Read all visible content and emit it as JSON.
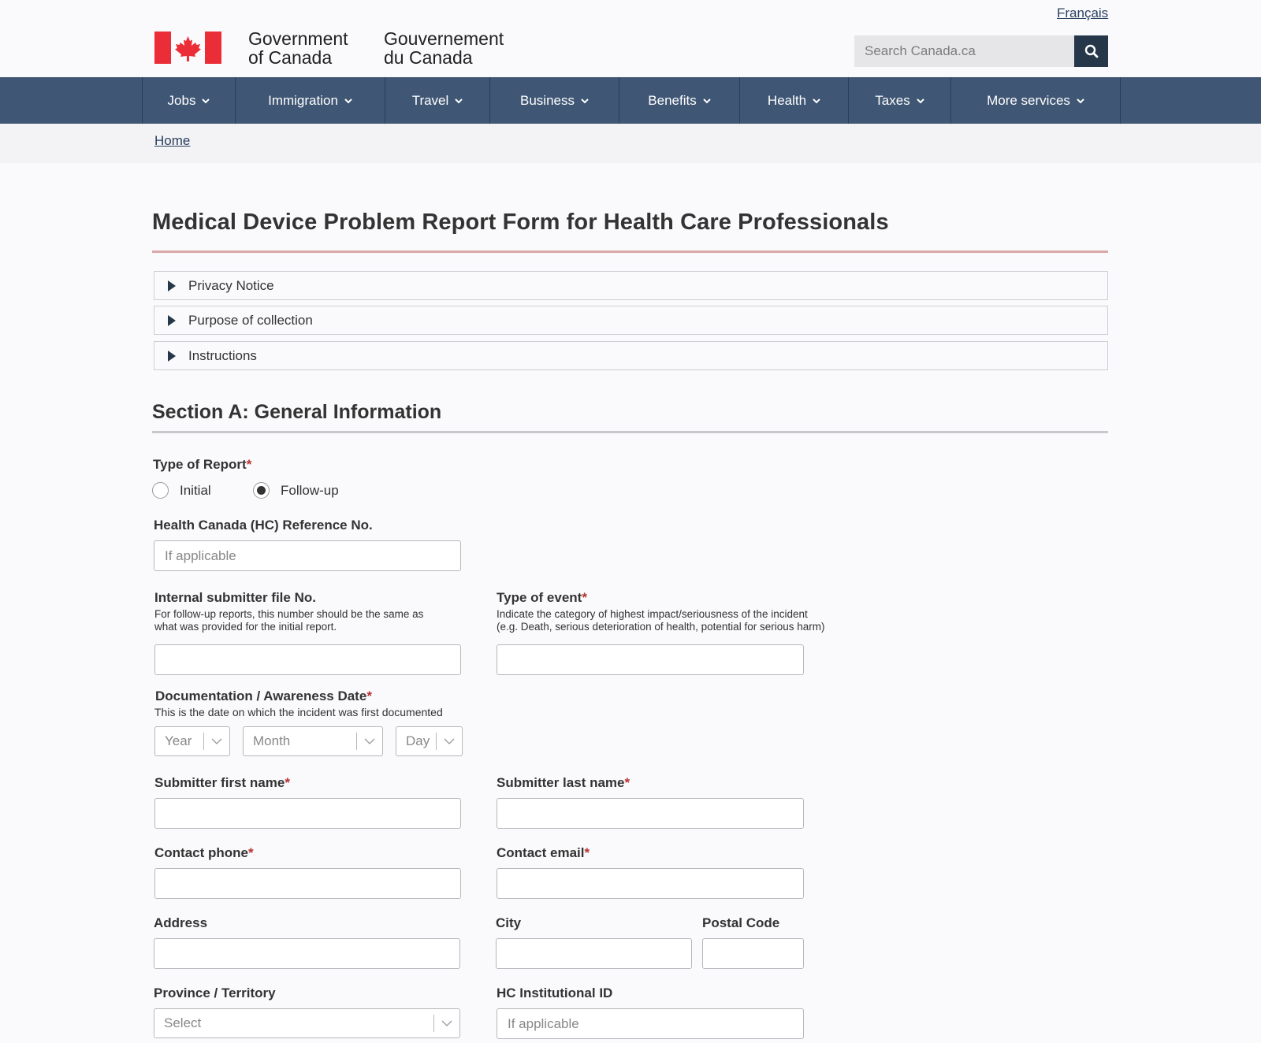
{
  "header": {
    "language_link": "Français",
    "wordmark_en_line1": "Government",
    "wordmark_en_line2": "of Canada",
    "wordmark_fr_line1": "Gouvernement",
    "wordmark_fr_line2": "du Canada",
    "search_placeholder": "Search Canada.ca",
    "brand_color": "#26374a",
    "flag_color": "#eb2d37"
  },
  "nav": {
    "items": [
      "Jobs",
      "Immigration",
      "Travel",
      "Business",
      "Benefits",
      "Health",
      "Taxes",
      "More services"
    ]
  },
  "breadcrumb": {
    "home": "Home"
  },
  "page": {
    "title": "Medical Device Problem Report Form for Health Care Professionals",
    "accordions": [
      "Privacy Notice",
      "Purpose of collection",
      "Instructions"
    ],
    "section_title": "Section A: General Information"
  },
  "form": {
    "type_of_report": {
      "label": "Type of Report",
      "required_mark": "*",
      "options": [
        "Initial",
        "Follow-up"
      ],
      "selected": "Follow-up"
    },
    "hc_reference": {
      "label": "Health Canada (HC) Reference No.",
      "placeholder": "If applicable",
      "value": ""
    },
    "internal_file": {
      "label": "Internal submitter file No.",
      "hint_line1": "For follow-up reports, this number should be the same as",
      "hint_line2": "what was provided for the initial report.",
      "value": ""
    },
    "type_of_event": {
      "label": "Type of event",
      "required_mark": "*",
      "hint_line1": "Indicate the category of highest impact/seriousness of the incident",
      "hint_line2": "(e.g. Death, serious deterioration of health, potential for serious harm)",
      "value": ""
    },
    "awareness_date": {
      "label": "Documentation / Awareness Date",
      "required_mark": "*",
      "hint": "This is the date on which the incident was first documented",
      "year": "Year",
      "month": "Month",
      "day": "Day"
    },
    "first_name": {
      "label": "Submitter first name",
      "required_mark": "*",
      "value": ""
    },
    "last_name": {
      "label": "Submitter last name",
      "required_mark": "*",
      "value": ""
    },
    "phone": {
      "label": "Contact phone",
      "required_mark": "*",
      "value": ""
    },
    "email": {
      "label": "Contact email",
      "required_mark": "*",
      "value": ""
    },
    "address": {
      "label": "Address",
      "value": ""
    },
    "city": {
      "label": "City",
      "value": ""
    },
    "postal_code": {
      "label": "Postal Code",
      "value": ""
    },
    "province": {
      "label": "Province / Territory",
      "selected": "Select"
    },
    "hc_institutional_id": {
      "label": "HC Institutional ID",
      "placeholder": "If applicable",
      "value": ""
    }
  }
}
